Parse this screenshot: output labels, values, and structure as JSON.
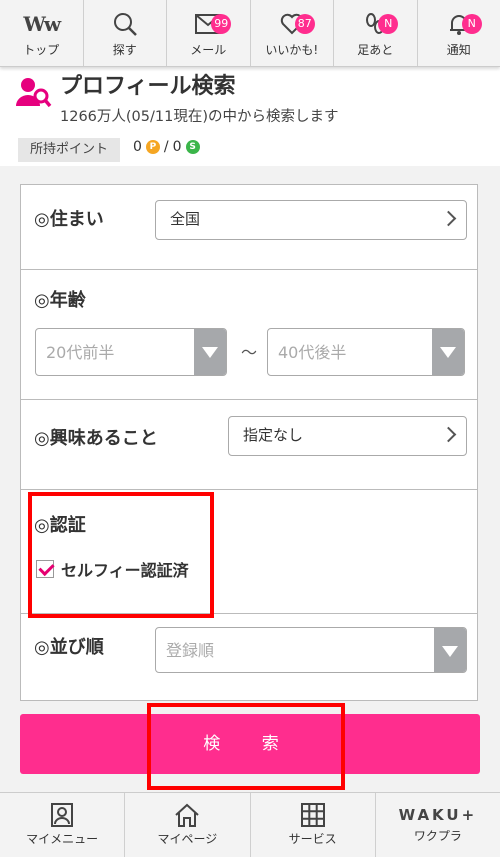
{
  "topnav": [
    {
      "label": "トップ",
      "icon": "ww-logo-icon",
      "badge": ""
    },
    {
      "label": "探す",
      "icon": "search-icon",
      "badge": ""
    },
    {
      "label": "メール",
      "icon": "mail-icon",
      "badge": "99"
    },
    {
      "label": "いいかも!",
      "icon": "heart-icon",
      "badge": "87"
    },
    {
      "label": "足あと",
      "icon": "footprint-icon",
      "badge": "N"
    },
    {
      "label": "通知",
      "icon": "bell-icon",
      "badge": "N"
    }
  ],
  "logo_text": "Ww",
  "header": {
    "title": "プロフィール検索",
    "subtitle": "1266万人(05/11現在)の中から検索します"
  },
  "points": {
    "label": "所持ポイント",
    "p_value": "0",
    "separator": "/",
    "s_value": "0",
    "p_coin": "P",
    "s_coin": "S"
  },
  "form": {
    "residence": {
      "label": "◎住まい",
      "value": "全国"
    },
    "age": {
      "label": "◎年齢",
      "from": "20代前半",
      "tilde": "〜",
      "to": "40代後半"
    },
    "interests": {
      "label": "◎興味あること",
      "value": "指定なし"
    },
    "verification": {
      "label": "◎認証",
      "checkbox_label": "セルフィー認証済",
      "checked": true
    },
    "sort": {
      "label": "◎並び順",
      "value": "登録順"
    }
  },
  "search_button": "検 索",
  "bottomnav": [
    {
      "label": "マイメニュー",
      "icon": "user-card-icon"
    },
    {
      "label": "マイページ",
      "icon": "home-icon"
    },
    {
      "label": "サービス",
      "icon": "grid-icon"
    },
    {
      "label": "ワクプラ",
      "icon": "wakuplus-logo-icon",
      "logo": "WAKU+"
    }
  ],
  "colors": {
    "accent": "#ff2d8e",
    "highlight": "#ff0000",
    "dropdown": "#a6a8ab",
    "check": "#e60071"
  }
}
